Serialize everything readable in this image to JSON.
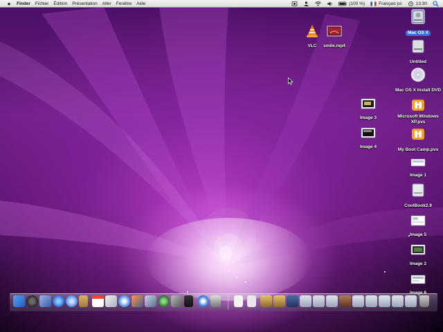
{
  "menubar": {
    "apple_icon": "apple-icon",
    "items": [
      "Finder",
      "Fichier",
      "Édition",
      "Présentation",
      "Aller",
      "Fenêtre",
      "Aide"
    ],
    "battery": "(100 %)",
    "language": "Français pc",
    "clock": "13:30"
  },
  "desktop_icons": [
    {
      "label": "VLC",
      "icon": "vlc-icon"
    },
    {
      "label": "smile.mp4",
      "icon": "video-file-icon"
    },
    {
      "label": "Mac OS X",
      "icon": "hard-drive-icon",
      "selected": true
    },
    {
      "label": "Untitled",
      "icon": "hard-drive-icon"
    },
    {
      "label": "Mac OS X Install DVD",
      "icon": "dvd-icon"
    },
    {
      "label": "Image 3",
      "icon": "image-file-icon"
    },
    {
      "label": "Microsoft Windows XP.pvs",
      "icon": "parallels-icon"
    },
    {
      "label": "Image 4",
      "icon": "image-file-icon"
    },
    {
      "label": "My Boot Camp.pvs",
      "icon": "parallels-icon"
    },
    {
      "label": "Image 1",
      "icon": "image-file-icon"
    },
    {
      "label": "CoolBook2.9",
      "icon": "disk-image-icon"
    },
    {
      "label": "Image 5",
      "icon": "image-file-icon"
    },
    {
      "label": "Image 2",
      "icon": "image-file-icon"
    },
    {
      "label": "Image 6",
      "icon": "image-file-icon"
    }
  ],
  "colors": {
    "menubar": "#e8e8e8",
    "wallpaper_primary": "#6a1f86",
    "wallpaper_glow": "#e07af0",
    "selection": "#3b6fd6"
  }
}
